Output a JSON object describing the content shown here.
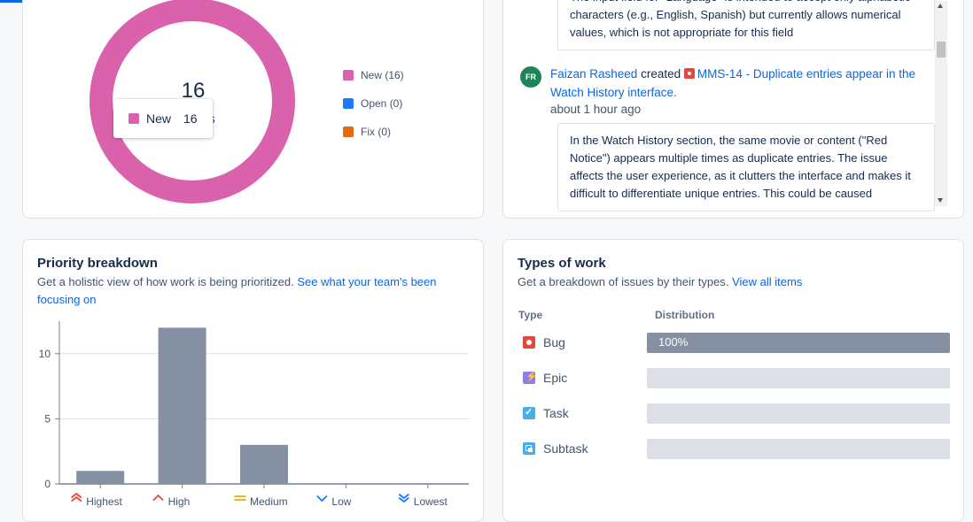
{
  "status": {
    "center_count": "16",
    "center_label": "es",
    "legend": [
      {
        "label": "New (16)",
        "color": "#da62ac"
      },
      {
        "label": "Open (0)",
        "color": "#1d7afc"
      },
      {
        "label": "Fix (0)",
        "color": "#e56910"
      }
    ],
    "tooltip": {
      "label": "New",
      "value": "16",
      "color": "#da62ac"
    }
  },
  "activity": {
    "top_desc": "The input field for \"Language\" is intended to accept only alphabetic characters (e.g., English, Spanish) but currently allows numerical values, which is not appropriate for this field",
    "avatar_initials": "FR",
    "user": "Faizan Rasheed",
    "action": "created",
    "issue": "MMS-14 - Duplicate entries appear in the Watch History interface.",
    "time": "about 1 hour ago",
    "desc": "In the Watch History section, the same movie or content (\"Red Notice\") appears multiple times as duplicate entries. The issue affects the user experience, as it clutters the interface and makes it difficult to differentiate unique entries. This could be caused"
  },
  "priority": {
    "title": "Priority breakdown",
    "subtitle": "Get a holistic view of how work is being prioritized.",
    "link": "See what your team's been focusing on"
  },
  "chart_data": {
    "type": "bar",
    "categories": [
      "Highest",
      "High",
      "Medium",
      "Low",
      "Lowest"
    ],
    "values": [
      1,
      12,
      3,
      0,
      0
    ],
    "yticks": [
      0,
      5,
      10
    ],
    "ylim": [
      0,
      12.5
    ],
    "bar_color": "#8590a2",
    "icon_colors": [
      "#e34935",
      "#e34935",
      "#e2b203",
      "#1d7afc",
      "#1d7afc"
    ],
    "grid": true
  },
  "types": {
    "title": "Types of work",
    "subtitle": "Get a breakdown of issues by their types.",
    "link": "View all items",
    "col_type": "Type",
    "col_dist": "Distribution",
    "rows": [
      {
        "label": "Bug",
        "percent": 100,
        "percent_label": "100%",
        "icon": "bug-icon",
        "color": "#e2483d"
      },
      {
        "label": "Epic",
        "percent": 0,
        "percent_label": "",
        "icon": "epic-icon",
        "color": "#8f7ee7"
      },
      {
        "label": "Task",
        "percent": 0,
        "percent_label": "",
        "icon": "task-icon",
        "color": "#4bade8"
      },
      {
        "label": "Subtask",
        "percent": 0,
        "percent_label": "",
        "icon": "subtask-icon",
        "color": "#4bade8"
      }
    ]
  }
}
